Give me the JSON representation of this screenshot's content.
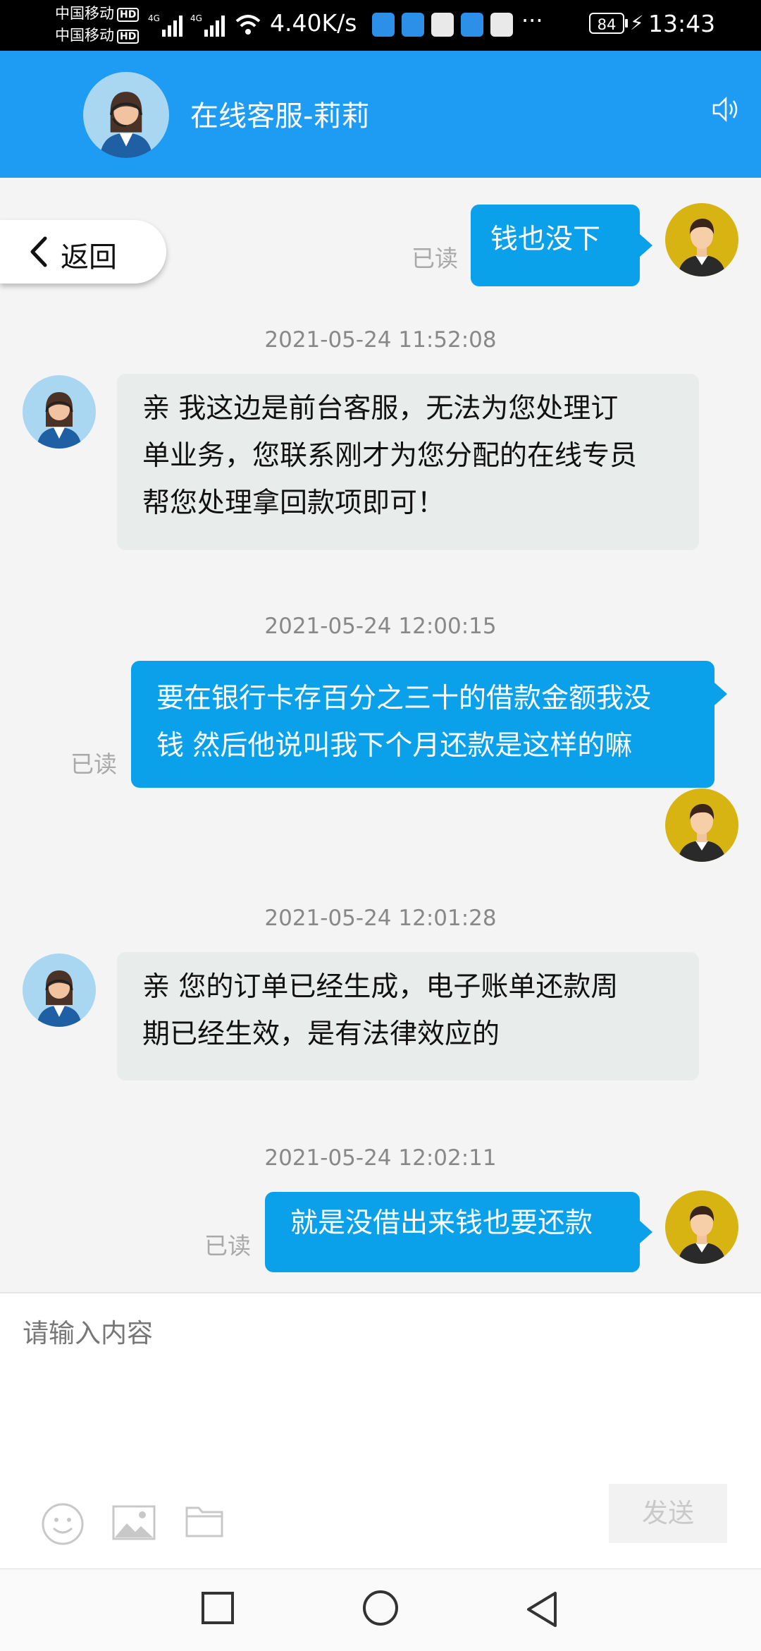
{
  "status_bar": {
    "carrier_1": "中国移动",
    "carrier_2": "中国移动",
    "hd_badge": "HD",
    "network_1": "4G",
    "network_2": "4G",
    "speed": "4.40K/s",
    "battery": "84",
    "time": "13:43",
    "more": "···"
  },
  "header": {
    "title": "在线客服-莉莉",
    "speaker_icon": "speaker-icon"
  },
  "back_button": {
    "label": "返回"
  },
  "messages": [
    {
      "from": "user",
      "text": "钱也没下",
      "read": "已读"
    },
    {
      "timestamp": "2021-05-24 11:52:08",
      "from": "agent",
      "lines": [
        "亲 我这边是前台客服，无法为您处理订",
        "单业务，您联系刚才为您分配的在线专员",
        "帮您处理拿回款项即可！"
      ]
    },
    {
      "timestamp": "2021-05-24 12:00:15",
      "from": "user",
      "lines": [
        "要在银行卡存百分之三十的借款金额我没",
        "钱 然后他说叫我下个月还款是这样的嘛"
      ],
      "read": "已读"
    },
    {
      "timestamp": "2021-05-24 12:01:28",
      "from": "agent",
      "lines": [
        "亲 您的订单已经生成，电子账单还款周",
        "期已经生效，是有法律效应的"
      ]
    },
    {
      "timestamp": "2021-05-24 12:02:11",
      "from": "user",
      "text": "就是没借出来钱也要还款",
      "read": "已读"
    }
  ],
  "input": {
    "placeholder": "请输入内容",
    "send_label": "发送",
    "tools": [
      "emoji-icon",
      "image-icon",
      "folder-icon"
    ]
  },
  "nav": {
    "icons": [
      "square-recents-icon",
      "circle-home-icon",
      "triangle-back-icon"
    ]
  },
  "colors": {
    "header": "#1e9bf3",
    "bubble_out": "#0aa0ea",
    "bubble_in": "#e8eceb"
  }
}
